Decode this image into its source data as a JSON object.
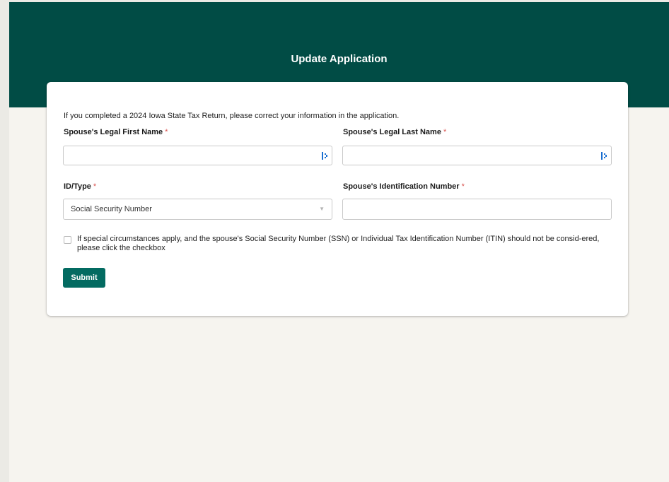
{
  "page": {
    "title": "Update Application",
    "intro": "If you completed a 2024 Iowa State Tax Return, please correct your information in the application."
  },
  "form": {
    "first_name": {
      "label": "Spouse's Legal First Name",
      "required_mark": "*",
      "value": ""
    },
    "last_name": {
      "label": "Spouse's Legal Last Name",
      "required_mark": "*",
      "value": ""
    },
    "id_type": {
      "label": "ID/Type",
      "required_mark": "*",
      "selected": "Social Security Number"
    },
    "id_number": {
      "label": "Spouse's Identification Number",
      "required_mark": "*",
      "value": ""
    },
    "special_circumstances": {
      "checked": false,
      "label": "If special circumstances apply, and the spouse's Social Security Number (SSN) or Individual Tax Identification Number (ITIN) should not be consid-ered, please click the checkbox"
    },
    "submit_label": "Submit"
  },
  "colors": {
    "banner": "#014c45",
    "submit_button": "#036b61",
    "required": "#d9534f",
    "background": "#f6f4ef"
  }
}
